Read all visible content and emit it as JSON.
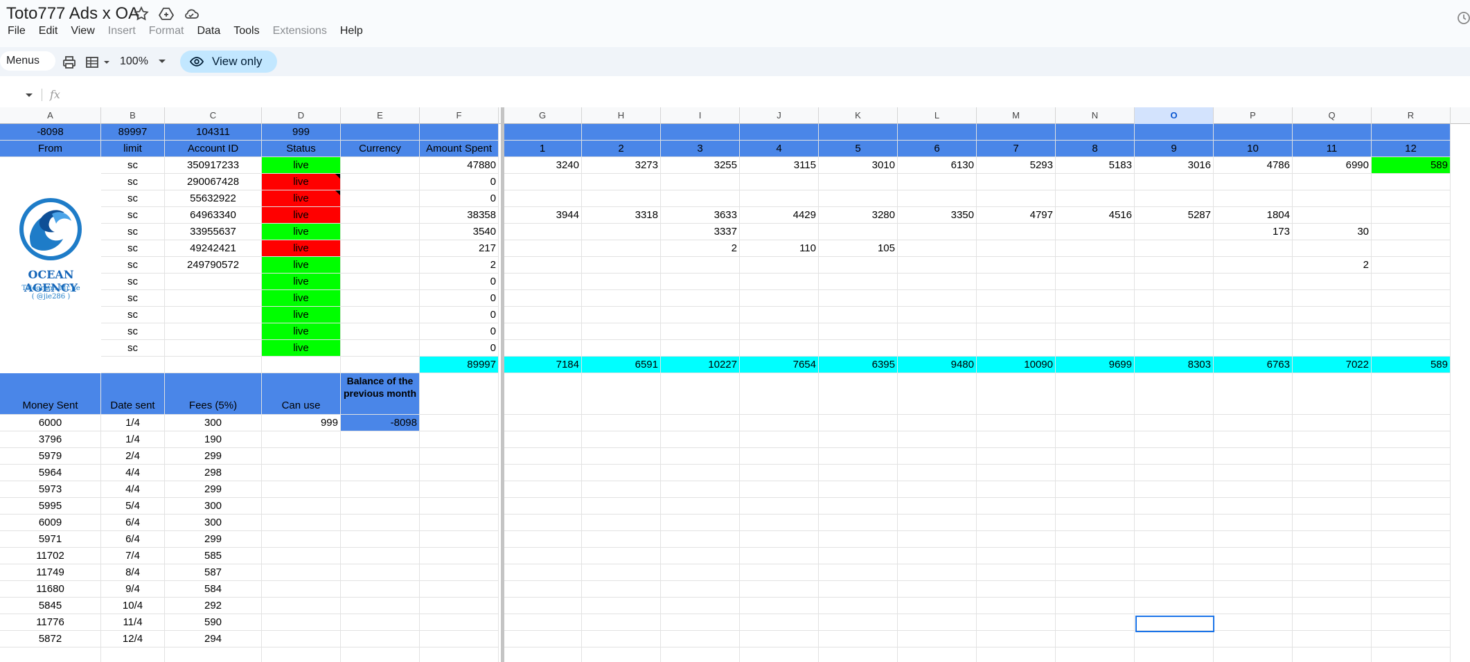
{
  "doc": {
    "title": "Toto777 Ads x OA",
    "menu": [
      {
        "label": "File",
        "disabled": false
      },
      {
        "label": "Edit",
        "disabled": false
      },
      {
        "label": "View",
        "disabled": false
      },
      {
        "label": "Insert",
        "disabled": true
      },
      {
        "label": "Format",
        "disabled": true
      },
      {
        "label": "Data",
        "disabled": false
      },
      {
        "label": "Tools",
        "disabled": false
      },
      {
        "label": "Extensions",
        "disabled": true
      },
      {
        "label": "Help",
        "disabled": false
      }
    ]
  },
  "toolbar": {
    "menus_label": "Menus",
    "zoom": "100%",
    "view_only_label": "View only"
  },
  "formula_bar": {
    "fx": "fx"
  },
  "columns": [
    "A",
    "B",
    "C",
    "D",
    "E",
    "F",
    "G",
    "H",
    "I",
    "J",
    "K",
    "L",
    "M",
    "N",
    "O",
    "P",
    "Q",
    "R"
  ],
  "selected_column": "O",
  "sheet": {
    "row1": {
      "A": "-8098",
      "B": "89997",
      "C": "104311",
      "D": "999"
    },
    "headers": [
      "From",
      "limit",
      "Account ID",
      "Status",
      "Currency",
      "Amount Spent",
      "1",
      "2",
      "3",
      "4",
      "5",
      "6",
      "7",
      "8",
      "9",
      "10",
      "11",
      "12"
    ],
    "accounts": [
      {
        "limit": "sc",
        "id": "350917233",
        "status": "live",
        "status_color": "green",
        "spent": "47880",
        "days": [
          "3240",
          "3273",
          "3255",
          "3115",
          "3010",
          "6130",
          "5293",
          "5183",
          "3016",
          "4786",
          "6990",
          "589"
        ]
      },
      {
        "limit": "sc",
        "id": "290067428",
        "status": "live",
        "status_color": "red",
        "spent": "0",
        "days": [
          "",
          "",
          "",
          "",
          "",
          "",
          "",
          "",
          "",
          "",
          "",
          ""
        ]
      },
      {
        "limit": "sc",
        "id": "55632922",
        "status": "live",
        "status_color": "red",
        "spent": "0",
        "days": [
          "",
          "",
          "",
          "",
          "",
          "",
          "",
          "",
          "",
          "",
          "",
          ""
        ]
      },
      {
        "limit": "sc",
        "id": "64963340",
        "status": "live",
        "status_color": "red",
        "spent": "38358",
        "days": [
          "3944",
          "3318",
          "3633",
          "4429",
          "3280",
          "3350",
          "4797",
          "4516",
          "5287",
          "1804",
          "",
          ""
        ]
      },
      {
        "limit": "sc",
        "id": "33955637",
        "status": "live",
        "status_color": "green",
        "spent": "3540",
        "days": [
          "",
          "",
          "3337",
          "",
          "",
          "",
          "",
          "",
          "",
          "173",
          "30",
          ""
        ]
      },
      {
        "limit": "sc",
        "id": "49242421",
        "status": "live",
        "status_color": "red",
        "spent": "217",
        "days": [
          "",
          "",
          "2",
          "110",
          "105",
          "",
          "",
          "",
          "",
          "",
          "",
          ""
        ]
      },
      {
        "limit": "sc",
        "id": "249790572",
        "status": "live",
        "status_color": "green",
        "spent": "2",
        "days": [
          "",
          "",
          "",
          "",
          "",
          "",
          "",
          "",
          "",
          "",
          "2",
          ""
        ]
      },
      {
        "limit": "sc",
        "id": "",
        "status": "live",
        "status_color": "green",
        "spent": "0",
        "days": [
          "",
          "",
          "",
          "",
          "",
          "",
          "",
          "",
          "",
          "",
          "",
          ""
        ]
      },
      {
        "limit": "sc",
        "id": "",
        "status": "live",
        "status_color": "green",
        "spent": "0",
        "days": [
          "",
          "",
          "",
          "",
          "",
          "",
          "",
          "",
          "",
          "",
          "",
          ""
        ]
      },
      {
        "limit": "sc",
        "id": "",
        "status": "live",
        "status_color": "green",
        "spent": "0",
        "days": [
          "",
          "",
          "",
          "",
          "",
          "",
          "",
          "",
          "",
          "",
          "",
          ""
        ]
      },
      {
        "limit": "sc",
        "id": "",
        "status": "live",
        "status_color": "green",
        "spent": "0",
        "days": [
          "",
          "",
          "",
          "",
          "",
          "",
          "",
          "",
          "",
          "",
          "",
          ""
        ]
      },
      {
        "limit": "sc",
        "id": "",
        "status": "live",
        "status_color": "green",
        "spent": "0",
        "days": [
          "",
          "",
          "",
          "",
          "",
          "",
          "",
          "",
          "",
          "",
          "",
          ""
        ]
      }
    ],
    "totals": {
      "spent": "89997",
      "days": [
        "7184",
        "6591",
        "10227",
        "7654",
        "6395",
        "9480",
        "10090",
        "9699",
        "8303",
        "6763",
        "7022",
        "589"
      ]
    },
    "logo": {
      "name": "OCEAN AGENCY",
      "line1": "Telegram: Mr.Jie",
      "line2": "( @jie286 )"
    },
    "payments_headers": [
      "Money Sent",
      "Date sent",
      "Fees (5%)",
      "Can use",
      "Balance of the previous month"
    ],
    "can_use": "999",
    "prev_balance": "-8098",
    "payments": [
      {
        "money": "6000",
        "date": "1/4",
        "fee": "300"
      },
      {
        "money": "3796",
        "date": "1/4",
        "fee": "190"
      },
      {
        "money": "5979",
        "date": "2/4",
        "fee": "299"
      },
      {
        "money": "5964",
        "date": "4/4",
        "fee": "298"
      },
      {
        "money": "5973",
        "date": "4/4",
        "fee": "299"
      },
      {
        "money": "5995",
        "date": "5/4",
        "fee": "300"
      },
      {
        "money": "6009",
        "date": "6/4",
        "fee": "300"
      },
      {
        "money": "5971",
        "date": "6/4",
        "fee": "299"
      },
      {
        "money": "11702",
        "date": "7/4",
        "fee": "585"
      },
      {
        "money": "11749",
        "date": "8/4",
        "fee": "587"
      },
      {
        "money": "11680",
        "date": "9/4",
        "fee": "584"
      },
      {
        "money": "5845",
        "date": "10/4",
        "fee": "292"
      },
      {
        "money": "11776",
        "date": "11/4",
        "fee": "590"
      },
      {
        "money": "5872",
        "date": "12/4",
        "fee": "294"
      }
    ]
  },
  "colors": {
    "blue_header": "#4a86e8",
    "live_green": "#00ff00",
    "dead_red": "#ff0000",
    "total_cyan": "#00ffff"
  }
}
